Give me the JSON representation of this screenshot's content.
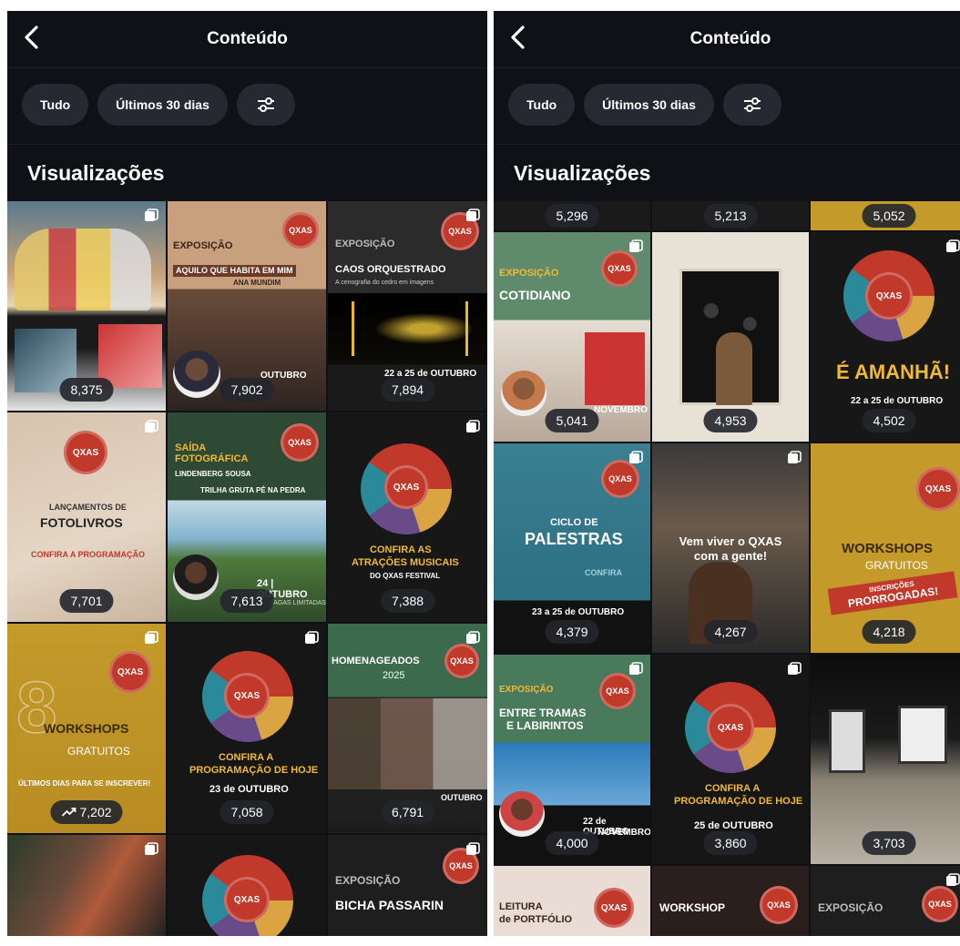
{
  "header": {
    "title": "Conteúdo"
  },
  "filters": {
    "all": "Tudo",
    "range": "Últimos 30 dias"
  },
  "section_title": "Visualizações",
  "left": {
    "r1": [
      {
        "views": "8,375"
      },
      {
        "views": "7,902",
        "l1": "EXPOSIÇÃO",
        "l2": "AQUILO QUE HABITA EM MIM",
        "l3": "ANA MUNDIM",
        "d": "OUTUBRO"
      },
      {
        "views": "7,894",
        "l1": "EXPOSIÇÃO",
        "l2": "CAOS ORQUESTRADO",
        "l3": "A cenografia do cedro em imagens",
        "d": "22 a 25 de OUTUBRO"
      }
    ],
    "r2": [
      {
        "views": "7,701",
        "l1": "LANÇAMENTOS DE",
        "l2": "FOTOLIVROS",
        "l3": "CONFIRA A PROGRAMAÇÃO"
      },
      {
        "views": "7,613",
        "l1": "SAÍDA FOTOGRÁFICA",
        "l2": "LINDENBERG SOUSA",
        "l3": "TRILHA GRUTA PÉ NA PEDRA",
        "d": "24 | OUTUBRO",
        "d2": "VAGAS LIMITADAS"
      },
      {
        "views": "7,388",
        "l1": "CONFIRA AS",
        "l2": "ATRAÇÕES MUSICAIS",
        "l3": "DO QXAS FESTIVAL"
      }
    ],
    "r3": [
      {
        "views": "7,202",
        "l1": "WORKSHOPS",
        "l2": "GRATUITOS",
        "l3": "ÚLTIMOS DIAS PARA SE INSCREVER!"
      },
      {
        "views": "7,058",
        "l1": "CONFIRA A",
        "l2": "PROGRAMAÇÃO DE HOJE",
        "d": "23 de OUTUBRO"
      },
      {
        "views": "6,791",
        "l1": "HOMENAGEADOS",
        "l2": "2025",
        "d": "OUTUBRO"
      }
    ],
    "r4": [
      {},
      {},
      {
        "l1": "EXPOSIÇÃO",
        "l2": "BICHA PASSARIN"
      }
    ]
  },
  "right": {
    "r0": [
      {
        "views": "5,296"
      },
      {
        "views": "5,213"
      },
      {
        "views": "5,052"
      }
    ],
    "r1": [
      {
        "views": "5,041",
        "l1": "EXPOSIÇÃO",
        "l2": "COTIDIANO",
        "d": "NOVEMBRO"
      },
      {
        "views": "4,953"
      },
      {
        "views": "4,502",
        "l1": "É AMANHÃ!",
        "d": "22 a 25 de OUTUBRO"
      }
    ],
    "r2": [
      {
        "views": "4,379",
        "l1": "CICLO DE",
        "l2": "PALESTRAS",
        "l3": "CONFIRA",
        "d": "23 a 25 de OUTUBRO"
      },
      {
        "views": "4,267",
        "l1": "Vem viver o QXAS",
        "l2": "com a gente!"
      },
      {
        "views": "4,218",
        "l1": "WORKSHOPS",
        "l2": "GRATUITOS",
        "l3": "INSCRIÇÕES",
        "l4": "PRORROGADAS!"
      }
    ],
    "r3": [
      {
        "views": "4,000",
        "l1": "EXPOSIÇÃO",
        "l2": "ENTRE TRAMAS",
        "l3": "E LABIRINTOS",
        "d": "22 de OUTUBRO",
        "d2": "NOVEMBRO"
      },
      {
        "views": "3,860",
        "l1": "CONFIRA A",
        "l2": "PROGRAMAÇÃO DE HOJE",
        "d": "25 de OUTUBRO"
      },
      {
        "views": "3,703"
      }
    ],
    "r4": [
      {
        "l1": "LEITURA",
        "l2": "de PORTFÓLIO"
      },
      {
        "l1": "WORKSHOP"
      },
      {
        "l1": "EXPOSIÇÃO"
      }
    ]
  },
  "logo_text": "QXAS",
  "colors": {
    "bg": "#0f1116",
    "chip": "#262932",
    "accent": "#c0392b",
    "gold": "#f2b935"
  }
}
